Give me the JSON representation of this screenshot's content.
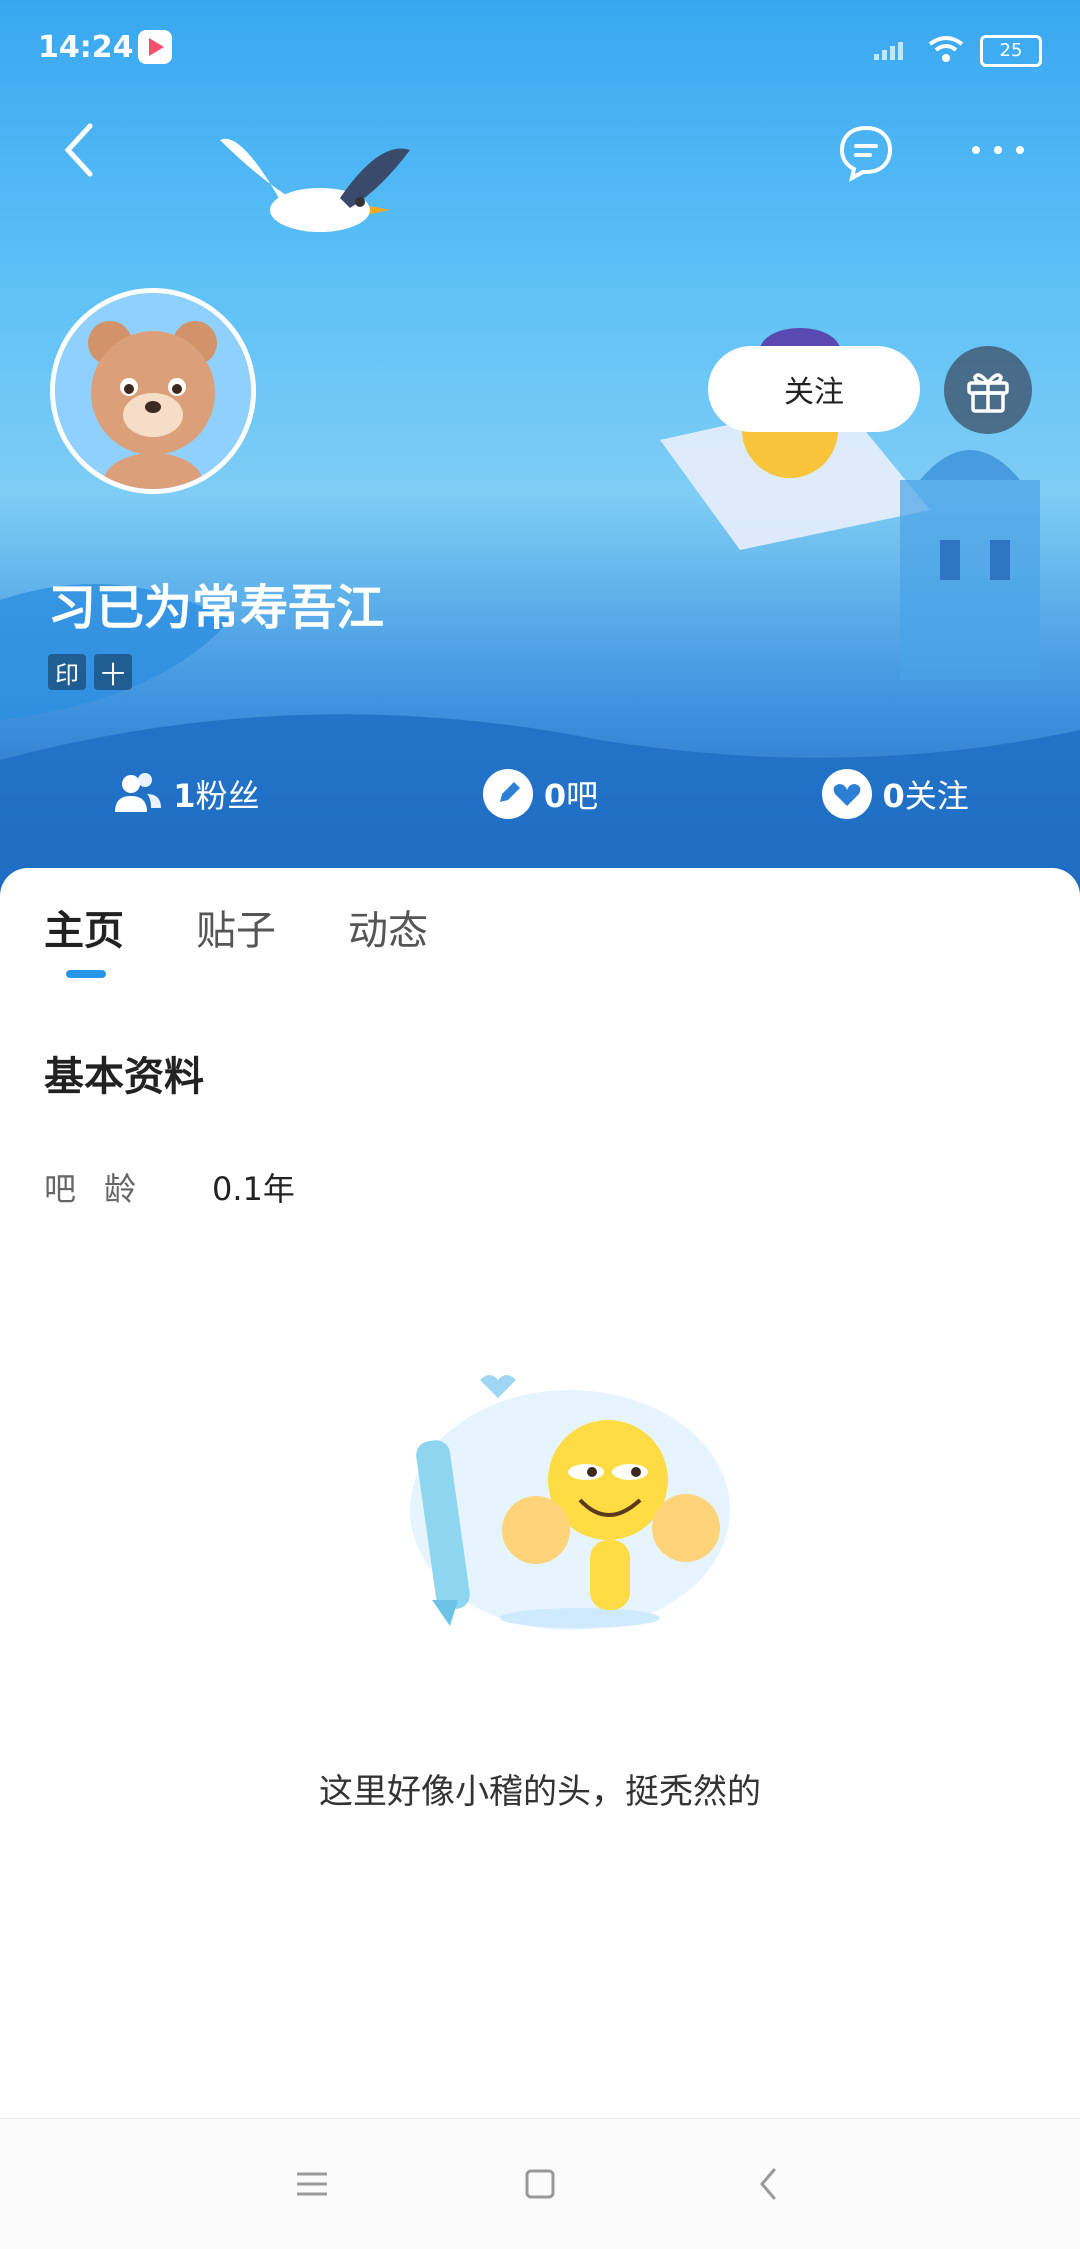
{
  "status_bar": {
    "time": "14:24",
    "battery": "25"
  },
  "profile": {
    "username": "习已为常寿吾江",
    "badges": [
      "印",
      "十"
    ],
    "follow_button": "关注"
  },
  "stats": {
    "fans": {
      "count": "1",
      "label": "粉丝"
    },
    "bars": {
      "count": "0",
      "label": "吧"
    },
    "following": {
      "count": "0",
      "label": "关注"
    }
  },
  "tabs": [
    {
      "label": "主页",
      "active": true
    },
    {
      "label": "贴子",
      "active": false
    },
    {
      "label": "动态",
      "active": false
    }
  ],
  "basic_info": {
    "title": "基本资料",
    "bar_age_label": "吧龄",
    "bar_age_value": "0.1年"
  },
  "empty_state": {
    "text": "这里好像小稽的头，挺秃然的"
  },
  "icons": {
    "back": "back-icon",
    "message": "message-icon",
    "more": "more-icon",
    "gift": "gift-icon",
    "fans": "users-icon",
    "bars": "pencil-icon",
    "following": "heart-icon",
    "nav_menu": "menu-icon",
    "nav_home": "square-home-icon",
    "nav_back": "chevron-left-icon"
  },
  "colors": {
    "accent": "#2796e8",
    "header_top": "#38a7f0",
    "header_bottom": "#1e64b8"
  }
}
